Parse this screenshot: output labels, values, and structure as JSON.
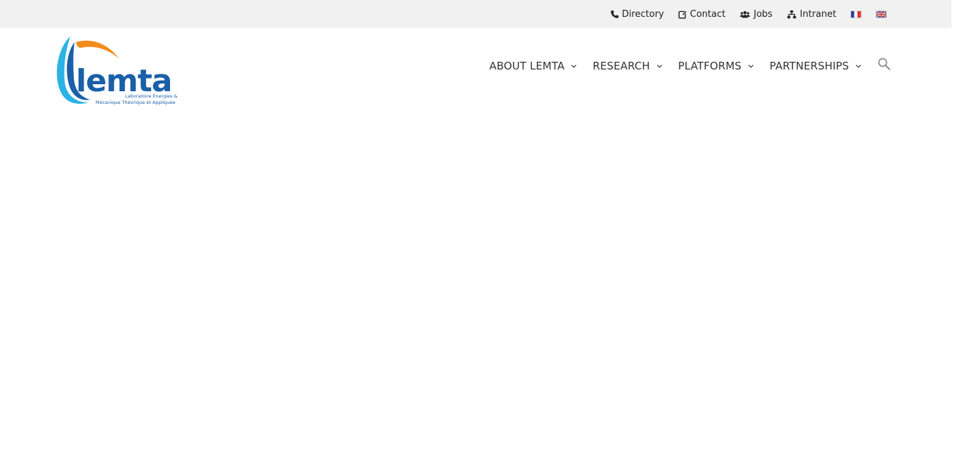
{
  "topbar": {
    "links": [
      {
        "label": "Directory",
        "icon": "phone-icon"
      },
      {
        "label": "Contact",
        "icon": "edit-icon"
      },
      {
        "label": "Jobs",
        "icon": "users-icon"
      },
      {
        "label": "Intranet",
        "icon": "sitemap-icon"
      }
    ],
    "languages": [
      "fr-flag-icon",
      "en-flag-icon"
    ]
  },
  "logo": {
    "name": "lemta",
    "tagline_line1": "Laboratoire Énergies &",
    "tagline_line2": "Mécanique Théorique et Appliquée",
    "colors": {
      "blue": "#1a5fa8",
      "light_blue": "#2cb3e6",
      "orange": "#f28c1c"
    }
  },
  "nav": {
    "items": [
      {
        "label": "ABOUT LEMTA"
      },
      {
        "label": "RESEARCH"
      },
      {
        "label": "PLATFORMS"
      },
      {
        "label": "PARTNERSHIPS"
      }
    ],
    "search_icon": "search-icon"
  },
  "colors": {
    "topbar_bg": "#f1f1f1",
    "text": "#333333",
    "icon_gray": "#999999"
  }
}
